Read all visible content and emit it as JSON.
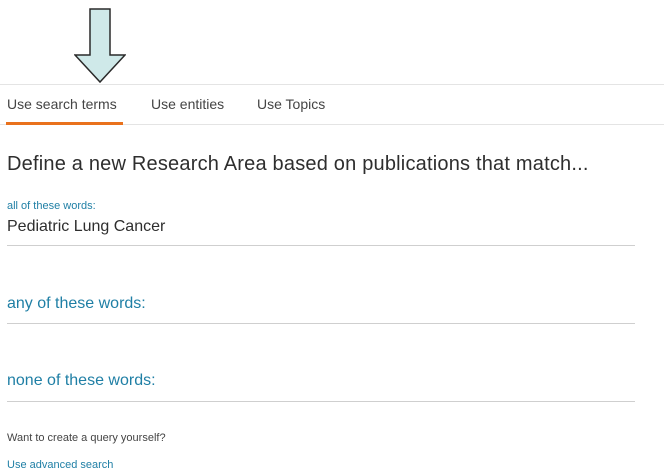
{
  "tabs": [
    {
      "label": "Use search terms",
      "active": true
    },
    {
      "label": "Use entities",
      "active": false
    },
    {
      "label": "Use Topics",
      "active": false
    }
  ],
  "heading": "Define a new Research Area based on publications that match...",
  "fields": {
    "all_words": {
      "label": "all of these words:",
      "value": "Pediatric Lung Cancer"
    },
    "any_words": {
      "placeholder": "any of these words:"
    },
    "none_words": {
      "placeholder": "none of these words:"
    }
  },
  "footer": {
    "hint": "Want to create a query yourself?",
    "advanced_link": "Use advanced search"
  },
  "colors": {
    "accent": "#e9711c",
    "link": "#1f7fa5",
    "arrow_fill": "#cfe9e9"
  },
  "icons": {
    "pointer_arrow": "down-arrow-icon"
  }
}
